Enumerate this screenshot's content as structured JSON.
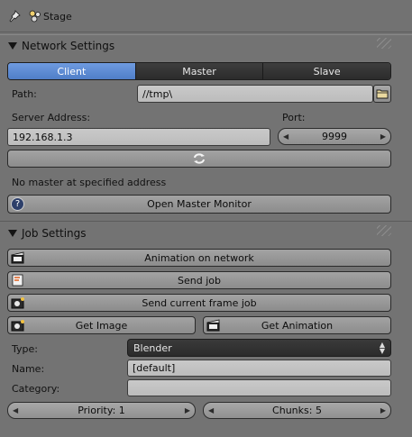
{
  "header": {
    "title": "Stage"
  },
  "network_settings": {
    "title": "Network Settings",
    "modes": [
      "Client",
      "Master",
      "Slave"
    ],
    "active_mode": "Client",
    "path_label": "Path:",
    "path_value": "//tmp\\",
    "server_address_label": "Server Address:",
    "server_address_value": "192.168.1.3",
    "port_label": "Port:",
    "port_value": "9999",
    "status_message": "No master at specified address",
    "open_monitor_label": "Open Master Monitor"
  },
  "job_settings": {
    "title": "Job Settings",
    "animation_on_network_label": "Animation on network",
    "send_job_label": "Send job",
    "send_current_frame_label": "Send current frame job",
    "get_image_label": "Get Image",
    "get_animation_label": "Get Animation",
    "type_label": "Type:",
    "type_value": "Blender",
    "name_label": "Name:",
    "name_value": "[default]",
    "category_label": "Category:",
    "category_value": "",
    "priority_label": "Priority: 1",
    "chunks_label": "Chunks: 5"
  },
  "colors": {
    "background": "#737373",
    "active_tab": "#5a8ad4",
    "dark_widget": "#333333"
  }
}
